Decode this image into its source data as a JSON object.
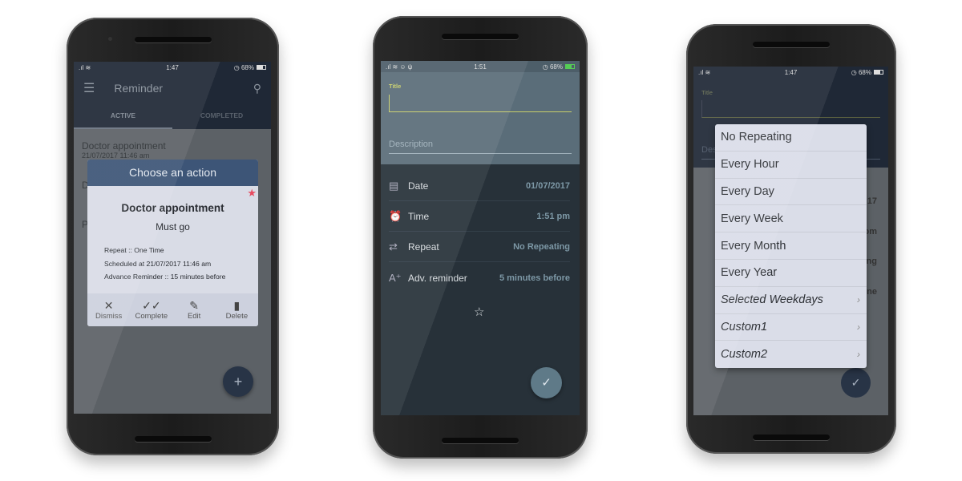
{
  "phone1": {
    "status": {
      "time": "1:47",
      "battery": "68%"
    },
    "app_title": "Reminder",
    "tabs": [
      {
        "label": "ACTIVE",
        "active": true
      },
      {
        "label": "COMPLETED",
        "active": false
      }
    ],
    "list": [
      {
        "title": "Doctor appointment",
        "subtitle": "21/07/2017  11:46 am"
      },
      {
        "title": "D",
        "subtitle": "2"
      },
      {
        "title": "P",
        "subtitle": "0"
      }
    ],
    "dialog": {
      "header": "Choose an action",
      "title": "Doctor appointment",
      "description": "Must go",
      "details": [
        "Repeat  ::  One Time",
        "Scheduled at 21/07/2017  11:46 am",
        "Advance Reminder  ::  15 minutes before"
      ],
      "actions": [
        {
          "label": "Dismiss",
          "icon": "close-icon"
        },
        {
          "label": "Complete",
          "icon": "double-check-icon"
        },
        {
          "label": "Edit",
          "icon": "pencil-icon"
        },
        {
          "label": "Delete",
          "icon": "trash-icon"
        }
      ],
      "star_color": "#e84a5f"
    },
    "fab_icon": "plus-icon"
  },
  "phone2": {
    "status": {
      "time": "1:51",
      "battery": "68%"
    },
    "title_label": "Title",
    "description_placeholder": "Description",
    "rows": [
      {
        "label": "Date",
        "value": "01/07/2017",
        "icon": "calendar-icon"
      },
      {
        "label": "Time",
        "value": "1:51 pm",
        "icon": "alarm-icon"
      },
      {
        "label": "Repeat",
        "value": "No Repeating",
        "icon": "repeat-icon"
      },
      {
        "label": "Adv. reminder",
        "value": "5 minutes before",
        "icon": "text-plus-icon"
      }
    ],
    "fab_icon": "check-icon",
    "accent": "#c8cf6a"
  },
  "phone3": {
    "status": {
      "time": "1:47",
      "battery": "68%"
    },
    "title_label": "Title",
    "description_placeholder": "Des",
    "row_values": [
      "17",
      "om",
      "ing",
      "one"
    ],
    "menu": [
      {
        "label": "No Repeating"
      },
      {
        "label": "Every Hour"
      },
      {
        "label": "Every Day"
      },
      {
        "label": "Every Week"
      },
      {
        "label": "Every Month"
      },
      {
        "label": "Every Year"
      },
      {
        "label": "Selected Weekdays",
        "italic": true,
        "submenu": true
      },
      {
        "label": "Custom1",
        "italic": true,
        "submenu": true
      },
      {
        "label": "Custom2",
        "italic": true,
        "submenu": true
      }
    ]
  }
}
